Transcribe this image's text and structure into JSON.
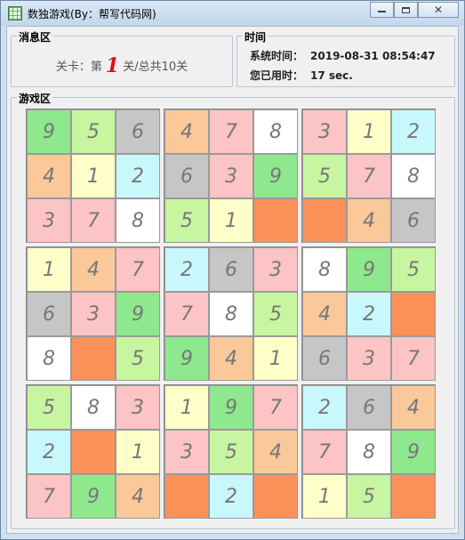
{
  "window": {
    "title": "数独游戏(By：帮写代码网)",
    "buttons": {
      "minimize": "minimize-icon",
      "maximize": "maximize-icon",
      "close": "close-icon"
    }
  },
  "message_area": {
    "title": "消息区",
    "level_prefix": "关卡：第",
    "level_number": "1",
    "level_suffix": "关/总共10关"
  },
  "time_area": {
    "title": "时间",
    "system_time_label": "系统时间：",
    "system_time_value": "2019-08-31 08:54:47",
    "elapsed_label": "您已用时：",
    "elapsed_value": "17 sec."
  },
  "game_area": {
    "title": "游戏区",
    "colors": {
      "G": "#8ee88e",
      "L": "#c8f5a0",
      "S": "#c6c6c6",
      "O": "#fbc899",
      "P": "#fcc4c4",
      "W": "#ffffff",
      "Y": "#fefec8",
      "C": "#c8f8fc",
      "D": "#fb9059"
    },
    "rows": [
      [
        [
          "9",
          "G"
        ],
        [
          "5",
          "L"
        ],
        [
          "6",
          "S"
        ],
        [
          "4",
          "O"
        ],
        [
          "7",
          "P"
        ],
        [
          "8",
          "W"
        ],
        [
          "3",
          "P"
        ],
        [
          "1",
          "Y"
        ],
        [
          "2",
          "C"
        ]
      ],
      [
        [
          "4",
          "O"
        ],
        [
          "1",
          "Y"
        ],
        [
          "2",
          "C"
        ],
        [
          "6",
          "S"
        ],
        [
          "3",
          "P"
        ],
        [
          "9",
          "G"
        ],
        [
          "5",
          "L"
        ],
        [
          "7",
          "P"
        ],
        [
          "8",
          "W"
        ]
      ],
      [
        [
          "3",
          "P"
        ],
        [
          "7",
          "P"
        ],
        [
          "8",
          "W"
        ],
        [
          "5",
          "L"
        ],
        [
          "1",
          "Y"
        ],
        [
          "",
          "D"
        ],
        [
          "",
          "D"
        ],
        [
          "4",
          "O"
        ],
        [
          "6",
          "S"
        ]
      ],
      [
        [
          "1",
          "Y"
        ],
        [
          "4",
          "O"
        ],
        [
          "7",
          "P"
        ],
        [
          "2",
          "C"
        ],
        [
          "6",
          "S"
        ],
        [
          "3",
          "P"
        ],
        [
          "8",
          "W"
        ],
        [
          "9",
          "G"
        ],
        [
          "5",
          "L"
        ]
      ],
      [
        [
          "6",
          "S"
        ],
        [
          "3",
          "P"
        ],
        [
          "9",
          "G"
        ],
        [
          "7",
          "P"
        ],
        [
          "8",
          "W"
        ],
        [
          "5",
          "L"
        ],
        [
          "4",
          "O"
        ],
        [
          "2",
          "C"
        ],
        [
          "",
          "D"
        ]
      ],
      [
        [
          "8",
          "W"
        ],
        [
          "",
          "D"
        ],
        [
          "5",
          "L"
        ],
        [
          "9",
          "G"
        ],
        [
          "4",
          "O"
        ],
        [
          "1",
          "Y"
        ],
        [
          "6",
          "S"
        ],
        [
          "3",
          "P"
        ],
        [
          "7",
          "P"
        ]
      ],
      [
        [
          "5",
          "L"
        ],
        [
          "8",
          "W"
        ],
        [
          "3",
          "P"
        ],
        [
          "1",
          "Y"
        ],
        [
          "9",
          "G"
        ],
        [
          "7",
          "P"
        ],
        [
          "2",
          "C"
        ],
        [
          "6",
          "S"
        ],
        [
          "4",
          "O"
        ]
      ],
      [
        [
          "2",
          "C"
        ],
        [
          "",
          "D"
        ],
        [
          "1",
          "Y"
        ],
        [
          "3",
          "P"
        ],
        [
          "5",
          "L"
        ],
        [
          "4",
          "O"
        ],
        [
          "7",
          "P"
        ],
        [
          "8",
          "W"
        ],
        [
          "9",
          "G"
        ]
      ],
      [
        [
          "7",
          "P"
        ],
        [
          "9",
          "G"
        ],
        [
          "4",
          "O"
        ],
        [
          "",
          "D"
        ],
        [
          "2",
          "C"
        ],
        [
          "",
          "D"
        ],
        [
          "1",
          "Y"
        ],
        [
          "5",
          "L"
        ],
        [
          "",
          "D"
        ]
      ]
    ]
  }
}
